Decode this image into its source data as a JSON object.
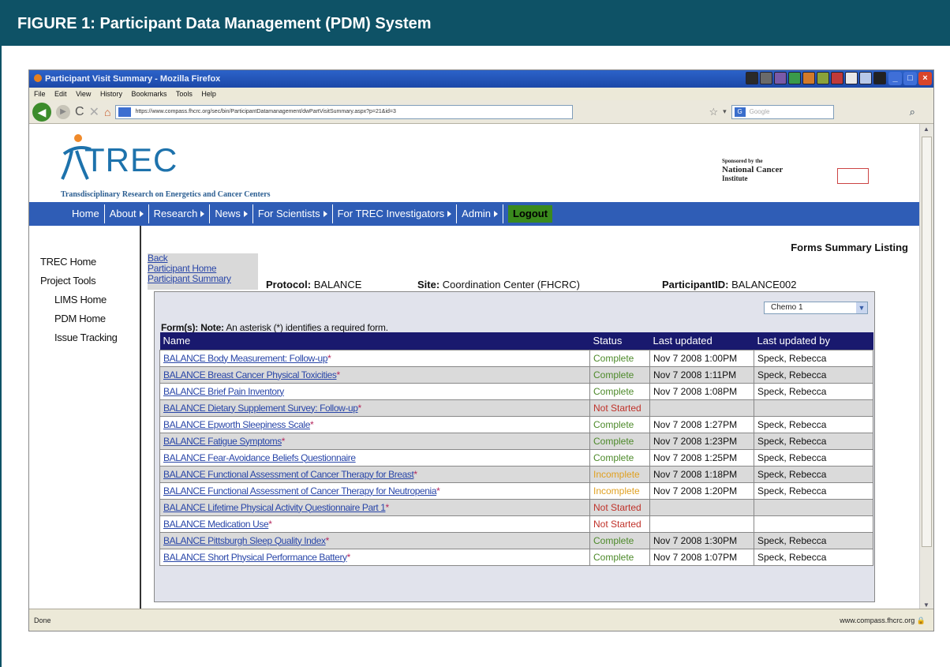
{
  "figure": {
    "title": "FIGURE 1: Participant Data Management (PDM) System"
  },
  "window": {
    "title": "Participant Visit Summary - Mozilla Firefox",
    "menu": [
      "File",
      "Edit",
      "View",
      "History",
      "Bookmarks",
      "Tools",
      "Help"
    ],
    "url": "https://www.compass.fhcrc.org/sec/bin/ParticipantDatamanagement/dwPartVisitSummary.aspx?p=21&id=3",
    "search_placeholder": "Google",
    "status_left": "Done",
    "status_right": "www.compass.fhcrc.org"
  },
  "site": {
    "logo_text": "TREC",
    "tagline": "Transdisciplinary Research on Energetics and Cancer Centers",
    "sponsor_line1": "Sponsored by the",
    "sponsor_line2": "National Cancer",
    "sponsor_line3": "Institute",
    "nav": [
      {
        "label": "Home",
        "arrow": false
      },
      {
        "label": "About",
        "arrow": true
      },
      {
        "label": "Research",
        "arrow": true
      },
      {
        "label": "News",
        "arrow": true
      },
      {
        "label": "For Scientists",
        "arrow": true
      },
      {
        "label": "For TREC Investigators",
        "arrow": true
      },
      {
        "label": "Admin",
        "arrow": true
      }
    ],
    "logout": "Logout"
  },
  "sidebar": {
    "items": [
      "TREC Home",
      "Project Tools",
      "LIMS Home",
      "PDM Home",
      "Issue Tracking"
    ]
  },
  "content": {
    "title": "Forms Summary Listing",
    "links": [
      "Back",
      "Participant Home",
      "Participant Summary"
    ],
    "protocol_label": "Protocol:",
    "protocol_value": "BALANCE",
    "site_label": "Site:",
    "site_value": "Coordination Center (FHCRC)",
    "participant_label": "ParticipantID:",
    "participant_value": "BALANCE002",
    "visit_select": "Chemo 1",
    "note_label": "Form(s): Note:",
    "note_text": "An asterisk (*) identifies a required form.",
    "columns": [
      "Name",
      "Status",
      "Last updated",
      "Last updated by"
    ],
    "rows": [
      {
        "name": "BALANCE Body Measurement: Follow-up",
        "req": "*",
        "status": "Complete",
        "date": "Nov 7 2008 1:00PM",
        "user": "Speck, Rebecca"
      },
      {
        "name": "BALANCE Breast Cancer Physical Toxicities",
        "req": "*",
        "status": "Complete",
        "date": "Nov 7 2008 1:11PM",
        "user": "Speck, Rebecca"
      },
      {
        "name": "BALANCE Brief Pain Inventory",
        "req": "",
        "status": "Complete",
        "date": "Nov 7 2008 1:08PM",
        "user": "Speck, Rebecca"
      },
      {
        "name": "BALANCE Dietary Supplement Survey: Follow-up",
        "req": "*",
        "status": "Not Started",
        "date": "",
        "user": ""
      },
      {
        "name": "BALANCE Epworth Sleepiness Scale",
        "req": "*",
        "status": "Complete",
        "date": "Nov 7 2008 1:27PM",
        "user": "Speck, Rebecca"
      },
      {
        "name": "BALANCE Fatigue Symptoms",
        "req": "*",
        "status": "Complete",
        "date": "Nov 7 2008 1:23PM",
        "user": "Speck, Rebecca"
      },
      {
        "name": "BALANCE Fear-Avoidance Beliefs Questionnaire",
        "req": "",
        "status": "Complete",
        "date": "Nov 7 2008 1:25PM",
        "user": "Speck, Rebecca"
      },
      {
        "name": "BALANCE Functional Assessment of Cancer Therapy for Breast",
        "req": "*",
        "status": "Incomplete",
        "date": "Nov 7 2008 1:18PM",
        "user": "Speck, Rebecca"
      },
      {
        "name": "BALANCE Functional Assessment of Cancer Therapy for Neutropenia",
        "req": "*",
        "status": "Incomplete",
        "date": "Nov 7 2008 1:20PM",
        "user": "Speck, Rebecca"
      },
      {
        "name": "BALANCE Lifetime Physical Activity Questionnaire Part 1",
        "req": "*",
        "status": "Not Started",
        "date": "",
        "user": ""
      },
      {
        "name": "BALANCE Medication Use",
        "req": "*",
        "status": "Not Started",
        "date": "",
        "user": ""
      },
      {
        "name": "BALANCE Pittsburgh Sleep Quality Index",
        "req": "*",
        "status": "Complete",
        "date": "Nov 7 2008 1:30PM",
        "user": "Speck, Rebecca"
      },
      {
        "name": "BALANCE Short Physical Performance Battery",
        "req": "*",
        "status": "Complete",
        "date": "Nov 7 2008 1:07PM",
        "user": "Speck, Rebecca"
      }
    ]
  },
  "colors": {
    "figure_header": "#0e5266",
    "nav_bar": "#2f5db6",
    "table_header": "#19196e",
    "status_complete": "#4d8a2a",
    "status_incomplete": "#e0a020",
    "status_not_started": "#c0322a",
    "link": "#2946a8"
  }
}
